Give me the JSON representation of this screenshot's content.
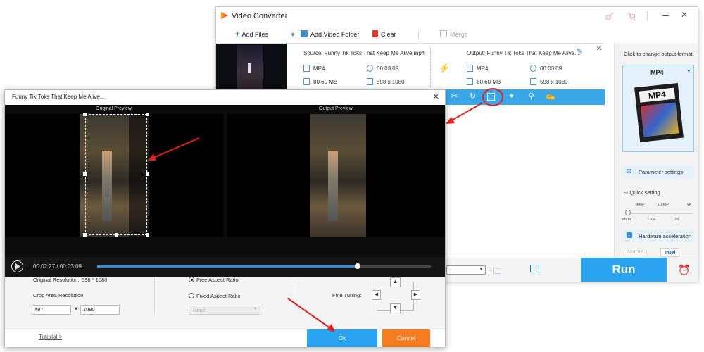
{
  "back_window": {
    "title": "Video Converter",
    "toolbar": {
      "add_files": "Add Files",
      "add_video_folder": "Add Video Folder",
      "clear": "Clear",
      "merge": "Merge"
    },
    "file_item": {
      "source_name": "Source: Funny Tik Toks That Keep Me Alive.mp4",
      "output_name": "Output: Funny Tik Toks That Keep Me Alive....",
      "source_format": "MP4",
      "source_duration": "00:03:09",
      "source_size": "80.60 MB",
      "source_resolution": "598 x 1080",
      "output_format": "MP4",
      "output_duration": "00:03:09",
      "output_size": "80.60 MB",
      "output_resolution": "598 x 1080"
    },
    "right_panel": {
      "hint": "Click to change output format:",
      "format": "MP4",
      "format_badge": "MP4",
      "parameter_settings": "Parameter settings",
      "quick_setting": "Quick setting",
      "scale_top": [
        "480P",
        "1080P",
        "4K"
      ],
      "scale_bottom": [
        "Default",
        "720P",
        "2K"
      ],
      "hardware_acceleration": "Hardware acceleration",
      "nvidia": "NVIDIA",
      "intel": "Intel"
    },
    "run_label": "Run"
  },
  "crop_dialog": {
    "title": "Funny Tik Toks That Keep Me Alive...",
    "original_preview_label": "Original Preview",
    "output_preview_label": "Output Preview",
    "current_time": "00:02:27",
    "time_separator": "/",
    "total_time": "00:03:09",
    "playback_progress": 0.78,
    "original_resolution_label": "Original Resolution:",
    "original_resolution_value": "598 * 1080",
    "crop_area_label": "Crop Area Resolution:",
    "crop_width": "497",
    "crop_times": "∗",
    "crop_height": "1080",
    "free_aspect_label": "Free Aspect Ratio",
    "fixed_aspect_label": "Fixed Aspect Ratio",
    "aspect_select_value": "None",
    "fine_tuning_label": "Fine Tuning:",
    "tutorial_link": "Tutorial >",
    "ok_label": "Ok",
    "cancel_label": "Cancel"
  },
  "colors": {
    "accent_blue": "#29a3ee",
    "edit_bar_blue": "#39a6e6",
    "cancel_orange": "#f57c1f",
    "annotation_red": "#e02020"
  }
}
